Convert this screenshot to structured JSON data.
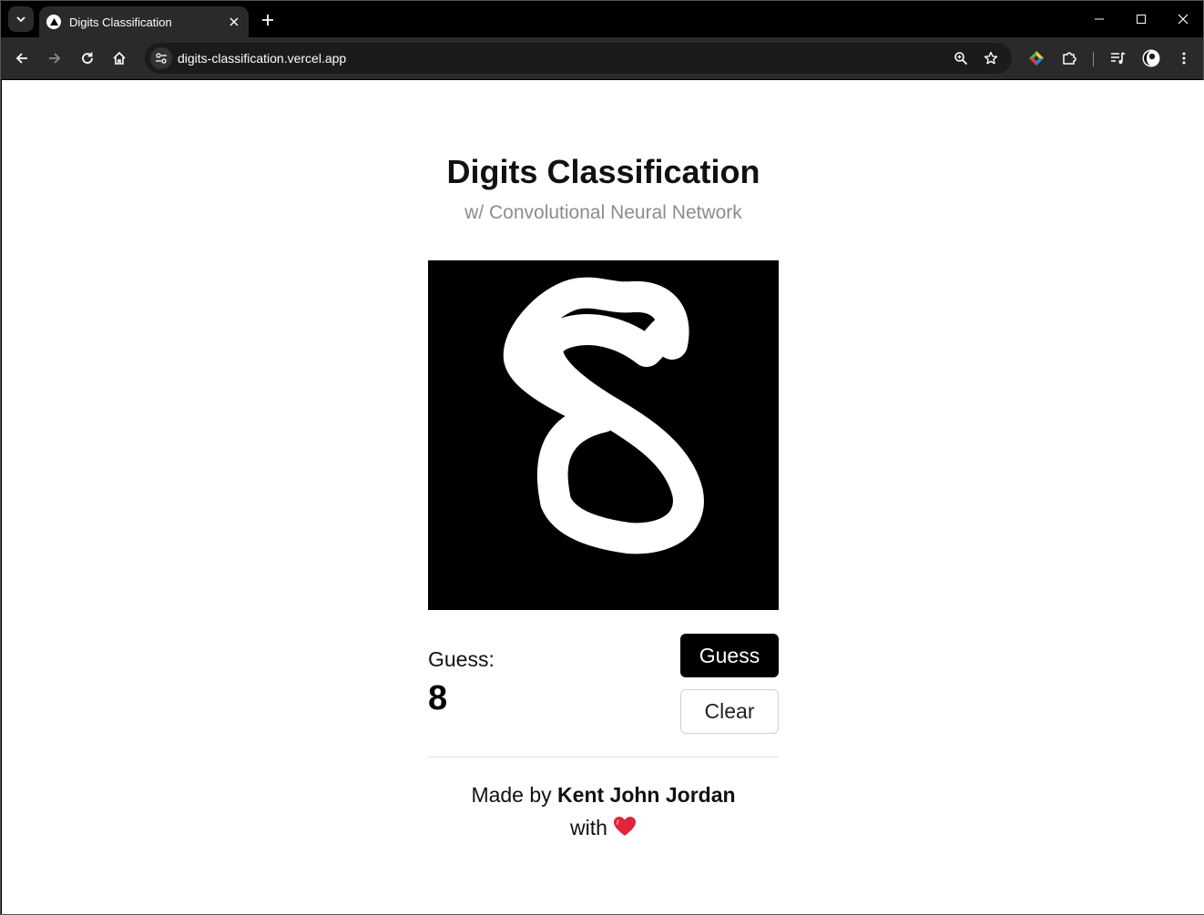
{
  "browser": {
    "tab_title": "Digits Classification",
    "url": "digits-classification.vercel.app"
  },
  "page": {
    "title": "Digits Classification",
    "subtitle": "w/ Convolutional Neural Network",
    "guess_label": "Guess:",
    "guess_value": "8",
    "guess_button": "Guess",
    "clear_button": "Clear",
    "footer_prefix": "Made by",
    "footer_author": "Kent John Jordan",
    "footer_with": "with"
  },
  "icons": {
    "heart": "heart-icon"
  },
  "colors": {
    "accent": "#000000",
    "heart": "#e0243a",
    "subtitle": "#8c8c8c"
  }
}
